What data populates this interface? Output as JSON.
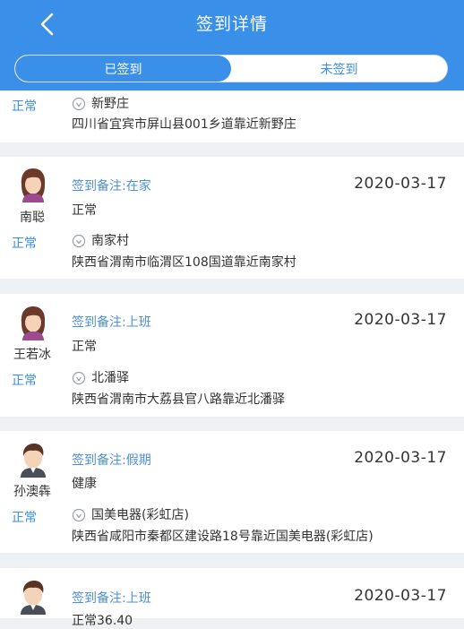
{
  "header": {
    "title": "签到详情",
    "back_icon": "chevron-left-icon"
  },
  "tabs": [
    {
      "label": "已签到",
      "active": true
    },
    {
      "label": "未签到",
      "active": false
    }
  ],
  "records": [
    {
      "status": "正常",
      "place": "新野庄",
      "address": "四川省宜宾市屏山县001乡道靠近新野庄"
    },
    {
      "name": "南聪",
      "avatar": "female-avatar",
      "remark": "签到备注:在家",
      "date": "2020-03-17",
      "health": "正常",
      "status": "正常",
      "place": "南家村",
      "address": "陕西省渭南市临渭区108国道靠近南家村"
    },
    {
      "name": "王若冰",
      "avatar": "female-avatar",
      "remark": "签到备注:上班",
      "date": "2020-03-17",
      "health": "正常",
      "status": "正常",
      "place": "北潘驿",
      "address": "陕西省渭南市大荔县官八路靠近北潘驿"
    },
    {
      "name": "孙澳犇",
      "avatar": "male-avatar",
      "remark": "签到备注:假期",
      "date": "2020-03-17",
      "health": "健康",
      "status": "正常",
      "place": "国美电器(彩虹店)",
      "address": "陕西省咸阳市秦都区建设路18号靠近国美电器(彩虹店)"
    },
    {
      "avatar": "male-avatar",
      "remark": "签到备注:上班",
      "date": "2020-03-17",
      "health": "正常36.40"
    }
  ],
  "colors": {
    "primary": "#3a8fe8",
    "remark_text": "#4b8fd9",
    "background": "#eef0f3"
  }
}
